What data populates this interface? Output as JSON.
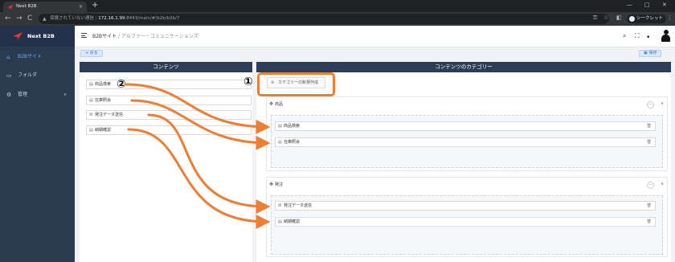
{
  "browser": {
    "tab_title": "Next B2B",
    "tab_close": "×",
    "new_tab": "+",
    "security_label": "保護されていない通信",
    "url_host": "172.16.1.99",
    "url_rest": ":8443/main/#/b2b/b2b/7",
    "incognito_label": "シークレット",
    "back": "←",
    "forward": "→",
    "reload": "C",
    "minimize": "—",
    "maximize": "□",
    "close": "✕"
  },
  "sidebar": {
    "brand": "Next B2B",
    "items": [
      {
        "label": "B2Bサイト",
        "icon": "home-icon",
        "glyph": "⌂"
      },
      {
        "label": "フォルダ",
        "icon": "folder-icon",
        "glyph": "▭"
      },
      {
        "label": "管理",
        "icon": "gear-icon",
        "glyph": "⚙"
      }
    ]
  },
  "header": {
    "breadcrumb_root": "B2Bサイト",
    "breadcrumb_sep": "/",
    "breadcrumb_current": "アルファー・コミュニケーションズ"
  },
  "toolbar": {
    "back_label": "+ 戻る",
    "save_label": "保存"
  },
  "left_panel": {
    "title": "コンテンツ",
    "items": [
      {
        "label": "商品検索",
        "glyph": "▤"
      },
      {
        "label": "在庫照会",
        "glyph": "▤"
      },
      {
        "label": "発注データ送信",
        "glyph": "☒"
      },
      {
        "label": "納期確認",
        "glyph": "▤"
      }
    ]
  },
  "right_panel": {
    "title": "コンテンツのカテゴリー",
    "new_category_label": "カテゴリーの新規作成",
    "categories": [
      {
        "name": "商品",
        "items": [
          "商品検索",
          "在庫照会"
        ]
      },
      {
        "name": "発注",
        "items": [
          "発注データ送信",
          "納期確認"
        ]
      }
    ]
  },
  "annotations": {
    "callout_1": "①",
    "callout_2": "②",
    "arrow_color": "#ef7d32"
  }
}
